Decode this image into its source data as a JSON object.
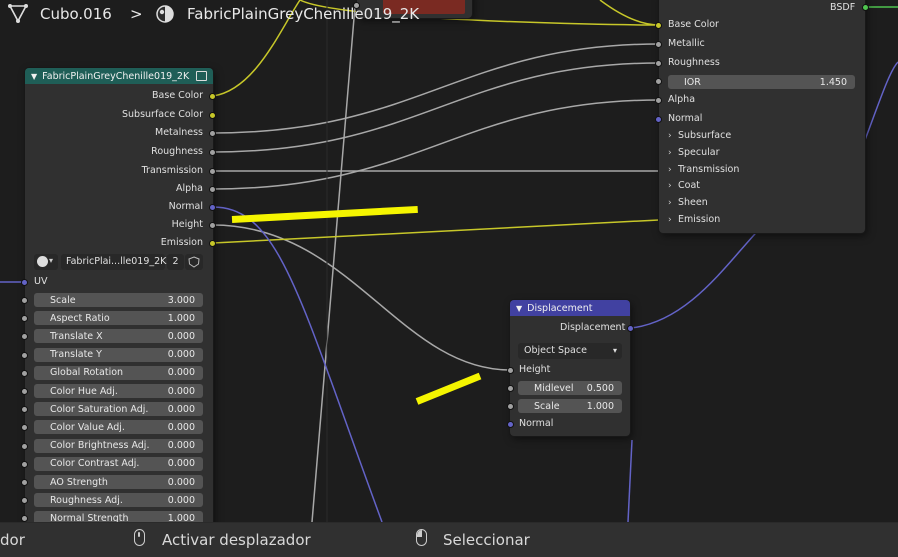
{
  "breadcrumb": {
    "object": "Cubo.016",
    "separator": ">",
    "material": "FabricPlainGreyChenille019_2K"
  },
  "texture_node": {
    "title": "FabricPlainGreyChenille019_2K",
    "outputs": [
      "Base Color",
      "Subsurface Color",
      "Metalness",
      "Roughness",
      "Transmission",
      "Alpha",
      "Normal",
      "Height",
      "Emission"
    ],
    "datablock": {
      "name": "FabricPlai...lle019_2K",
      "users": "2"
    },
    "uv_label": "UV",
    "params": [
      {
        "label": "Scale",
        "value": "3.000"
      },
      {
        "label": "Aspect Ratio",
        "value": "1.000"
      },
      {
        "label": "Translate X",
        "value": "0.000"
      },
      {
        "label": "Translate Y",
        "value": "0.000"
      },
      {
        "label": "Global Rotation",
        "value": "0.000"
      },
      {
        "label": "Color Hue Adj.",
        "value": "0.000"
      },
      {
        "label": "Color Saturation Adj.",
        "value": "0.000"
      },
      {
        "label": "Color Value Adj.",
        "value": "0.000"
      },
      {
        "label": "Color Brightness Adj.",
        "value": "0.000"
      },
      {
        "label": "Color Contrast Adj.",
        "value": "0.000"
      },
      {
        "label": "AO Strength",
        "value": "0.000"
      },
      {
        "label": "Roughness Adj.",
        "value": "0.000"
      },
      {
        "label": "Normal Strength",
        "value": "1.000"
      }
    ]
  },
  "bsdf_node": {
    "output": "BSDF",
    "inputs": [
      "Base Color",
      "Metallic",
      "Roughness"
    ],
    "ior": {
      "label": "IOR",
      "value": "1.450"
    },
    "inputs2": [
      "Alpha",
      "Normal"
    ],
    "panels": [
      "Subsurface",
      "Specular",
      "Transmission",
      "Coat",
      "Sheen",
      "Emission"
    ]
  },
  "displacement_node": {
    "title": "Displacement",
    "output": "Displacement",
    "space": "Object Space",
    "height_label": "Height",
    "midlevel": {
      "label": "Midlevel",
      "value": "0.500"
    },
    "scale": {
      "label": "Scale",
      "value": "1.000"
    },
    "normal_label": "Normal"
  },
  "statusbar": {
    "left_partial": "dor",
    "middle": "Activar desplazador",
    "right": "Seleccionar"
  },
  "colors": {
    "socket_color": "#c7c729",
    "socket_grey": "#a1a1a1",
    "socket_vector": "#6363c7",
    "socket_shader": "#4fc44f",
    "texture_header": "#1f5e57",
    "displacement_header": "#4141a1",
    "annotation": "#f5f500"
  }
}
